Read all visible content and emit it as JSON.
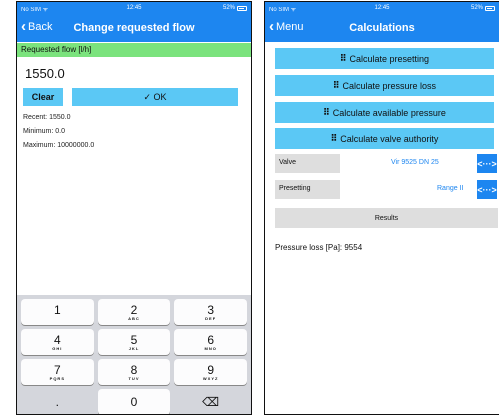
{
  "screen1": {
    "status": {
      "carrier": "No SIM ᯤ",
      "time": "12:45",
      "battery": "52%"
    },
    "nav": {
      "back": "Back",
      "title": "Change requested flow"
    },
    "label": "Requested flow [l/h]",
    "input_value": "1550.0",
    "clear": "Clear",
    "ok": "✓ OK",
    "recent": "Recent: 1550.0",
    "minimum": "Minimum: 0.0",
    "maximum": "Maximum: 10000000.0",
    "keys": [
      {
        "num": "1",
        "letters": ""
      },
      {
        "num": "2",
        "letters": "ABC"
      },
      {
        "num": "3",
        "letters": "DEF"
      },
      {
        "num": "4",
        "letters": "GHI"
      },
      {
        "num": "5",
        "letters": "JKL"
      },
      {
        "num": "6",
        "letters": "MNO"
      },
      {
        "num": "7",
        "letters": "PQRS"
      },
      {
        "num": "8",
        "letters": "TUV"
      },
      {
        "num": "9",
        "letters": "WXYZ"
      },
      {
        "num": ".",
        "letters": ""
      },
      {
        "num": "0",
        "letters": ""
      },
      {
        "num": "⌫",
        "letters": ""
      }
    ]
  },
  "screen2": {
    "status": {
      "carrier": "No SIM ᯤ",
      "time": "12:45",
      "battery": "52%"
    },
    "nav": {
      "back": "Menu",
      "title": "Calculations"
    },
    "buttons": [
      "Calculate presetting",
      "Calculate pressure loss",
      "Calculate available pressure",
      "Calculate valve authority"
    ],
    "valve": {
      "label": "Valve",
      "value": "Vir 9525   DN 25",
      "arrows": "<···>"
    },
    "presetting": {
      "label": "Presetting",
      "value": "Range II",
      "arrows": "<···>"
    },
    "results": "Results",
    "result_text": "Pressure loss [Pa]: 9554"
  },
  "colors": {
    "accent": "#1d86f0",
    "button": "#5bc8f5",
    "green": "#7be37d",
    "grey": "#dedede"
  }
}
